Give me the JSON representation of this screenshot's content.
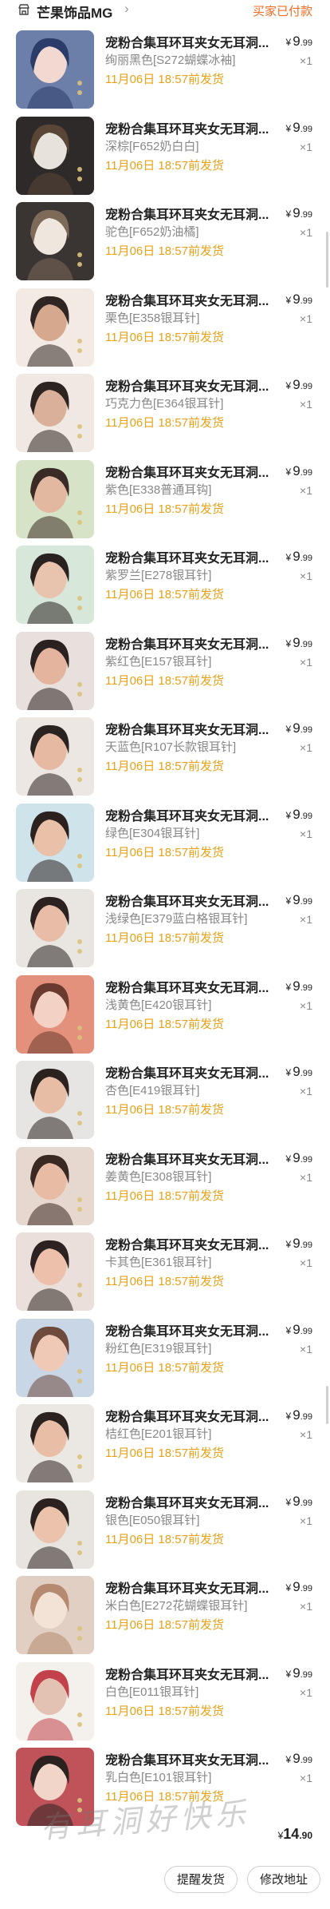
{
  "store": {
    "name": "芒果饰品MG",
    "chevron": "›",
    "status": "买家已付款",
    "icon": "store-icon"
  },
  "items": [
    {
      "title": "宠粉合集耳环耳夹女无耳洞...",
      "variant": "绚丽黑色[S272蝴蝶冰袖]",
      "ship": "11月06日 18:57前发货",
      "yen": "¥",
      "int": "9",
      "dec": ".99",
      "qty": "×1",
      "thumb": {
        "bg": "#6b7fa8",
        "fg": "#f1d8d0",
        "accent": "#2b3b6a"
      }
    },
    {
      "title": "宠粉合集耳环耳夹女无耳洞...",
      "variant": "深棕[F652奶白白]",
      "ship": "11月06日 18:57前发货",
      "yen": "¥",
      "int": "9",
      "dec": ".99",
      "qty": "×1",
      "thumb": {
        "bg": "#2f2a2a",
        "fg": "#e8e2dc",
        "accent": "#5a4636"
      }
    },
    {
      "title": "宠粉合集耳环耳夹女无耳洞...",
      "variant": "驼色[F652奶油橘]",
      "ship": "11月06日 18:57前发货",
      "yen": "¥",
      "int": "9",
      "dec": ".99",
      "qty": "×1",
      "thumb": {
        "bg": "#3a3433",
        "fg": "#efe6de",
        "accent": "#7e6a58"
      }
    },
    {
      "title": "宠粉合集耳环耳夹女无耳洞...",
      "variant": "栗色[E358银耳针]",
      "ship": "11月06日 18:57前发货",
      "yen": "¥",
      "int": "9",
      "dec": ".99",
      "qty": "×1",
      "thumb": {
        "bg": "#f3eae4",
        "fg": "#d6a98f",
        "accent": "#2f2624"
      }
    },
    {
      "title": "宠粉合集耳环耳夹女无耳洞...",
      "variant": "巧克力色[E364银耳针]",
      "ship": "11月06日 18:57前发货",
      "yen": "¥",
      "int": "9",
      "dec": ".99",
      "qty": "×1",
      "thumb": {
        "bg": "#f0e8e3",
        "fg": "#d9b19a",
        "accent": "#2d2421"
      }
    },
    {
      "title": "宠粉合集耳环耳夹女无耳洞...",
      "variant": "紫色[E338普通耳钩]",
      "ship": "11月06日 18:57前发货",
      "yen": "¥",
      "int": "9",
      "dec": ".99",
      "qty": "×1",
      "thumb": {
        "bg": "#d7e3c6",
        "fg": "#e3b8a1",
        "accent": "#3a2b26"
      }
    },
    {
      "title": "宠粉合集耳环耳夹女无耳洞...",
      "variant": "紫罗兰[E278银耳针]",
      "ship": "11月06日 18:57前发货",
      "yen": "¥",
      "int": "9",
      "dec": ".99",
      "qty": "×1",
      "thumb": {
        "bg": "#d7e7d9",
        "fg": "#e8c3ad",
        "accent": "#2a2221"
      }
    },
    {
      "title": "宠粉合集耳环耳夹女无耳洞...",
      "variant": "紫红色[E157银耳针]",
      "ship": "11月06日 18:57前发货",
      "yen": "¥",
      "int": "9",
      "dec": ".99",
      "qty": "×1",
      "thumb": {
        "bg": "#e8e0dc",
        "fg": "#e4b49f",
        "accent": "#2a2121"
      }
    },
    {
      "title": "宠粉合集耳环耳夹女无耳洞...",
      "variant": "天蓝色[R107长款银耳针]",
      "ship": "11月06日 18:57前发货",
      "yen": "¥",
      "int": "9",
      "dec": ".99",
      "qty": "×1",
      "thumb": {
        "bg": "#ece7e3",
        "fg": "#e6b9a3",
        "accent": "#2b2320"
      }
    },
    {
      "title": "宠粉合集耳环耳夹女无耳洞...",
      "variant": "绿色[E304银耳针]",
      "ship": "11月06日 18:57前发货",
      "yen": "¥",
      "int": "9",
      "dec": ".99",
      "qty": "×1",
      "thumb": {
        "bg": "#cfe3ea",
        "fg": "#e9c0a8",
        "accent": "#2b2220"
      }
    },
    {
      "title": "宠粉合集耳环耳夹女无耳洞...",
      "variant": "浅绿色[E379蓝白格银耳针]",
      "ship": "11月06日 18:57前发货",
      "yen": "¥",
      "int": "9",
      "dec": ".99",
      "qty": "×1",
      "thumb": {
        "bg": "#e9e6e2",
        "fg": "#e8bca6",
        "accent": "#2a2120"
      }
    },
    {
      "title": "宠粉合集耳环耳夹女无耳洞...",
      "variant": "浅黄色[E420银耳针]",
      "ship": "11月06日 18:57前发货",
      "yen": "¥",
      "int": "9",
      "dec": ".99",
      "qty": "×1",
      "thumb": {
        "bg": "#e3907c",
        "fg": "#f3d1c4",
        "accent": "#6a3a2e"
      }
    },
    {
      "title": "宠粉合集耳环耳夹女无耳洞...",
      "variant": "杏色[E419银耳针]",
      "ship": "11月06日 18:57前发货",
      "yen": "¥",
      "int": "9",
      "dec": ".99",
      "qty": "×1",
      "thumb": {
        "bg": "#e7e5e3",
        "fg": "#e7bda5",
        "accent": "#2b2220"
      }
    },
    {
      "title": "宠粉合集耳环耳夹女无耳洞...",
      "variant": "姜黄色[E308银耳针]",
      "ship": "11月06日 18:57前发货",
      "yen": "¥",
      "int": "9",
      "dec": ".99",
      "qty": "×1",
      "thumb": {
        "bg": "#e6d8cf",
        "fg": "#e8bca4",
        "accent": "#3a2823"
      }
    },
    {
      "title": "宠粉合集耳环耳夹女无耳洞...",
      "variant": "卡其色[E361银耳针]",
      "ship": "11月06日 18:57前发货",
      "yen": "¥",
      "int": "9",
      "dec": ".99",
      "qty": "×1",
      "thumb": {
        "bg": "#eadfda",
        "fg": "#ecc0ab",
        "accent": "#2c2221"
      }
    },
    {
      "title": "宠粉合集耳环耳夹女无耳洞...",
      "variant": "粉红色[E319银耳针]",
      "ship": "11月06日 18:57前发货",
      "yen": "¥",
      "int": "9",
      "dec": ".99",
      "qty": "×1",
      "thumb": {
        "bg": "#c9d6e6",
        "fg": "#efc9b6",
        "accent": "#6d4a3c"
      }
    },
    {
      "title": "宠粉合集耳环耳夹女无耳洞...",
      "variant": "桔红色[E201银耳针]",
      "ship": "11月06日 18:57前发货",
      "yen": "¥",
      "int": "9",
      "dec": ".99",
      "qty": "×1",
      "thumb": {
        "bg": "#ebe7e2",
        "fg": "#e9bea7",
        "accent": "#2b2220"
      }
    },
    {
      "title": "宠粉合集耳环耳夹女无耳洞...",
      "variant": "银色[E050银耳针]",
      "ship": "11月06日 18:57前发货",
      "yen": "¥",
      "int": "9",
      "dec": ".99",
      "qty": "×1",
      "thumb": {
        "bg": "#e8e5e1",
        "fg": "#ebc2ab",
        "accent": "#2b2220"
      }
    },
    {
      "title": "宠粉合集耳环耳夹女无耳洞...",
      "variant": "米白色[E272花蝴蝶银耳针]",
      "ship": "11月06日 18:57前发货",
      "yen": "¥",
      "int": "9",
      "dec": ".99",
      "qty": "×1",
      "thumb": {
        "bg": "#e0cfc2",
        "fg": "#f2e3d6",
        "accent": "#b58a70"
      }
    },
    {
      "title": "宠粉合集耳环耳夹女无耳洞...",
      "variant": "白色[E011银耳针]",
      "ship": "11月06日 18:57前发货",
      "yen": "¥",
      "int": "9",
      "dec": ".99",
      "qty": "×1",
      "thumb": {
        "bg": "#f4f0ec",
        "fg": "#e3c2b3",
        "accent": "#c2414b"
      }
    },
    {
      "title": "宠粉合集耳环耳夹女无耳洞...",
      "variant": "乳白色[E101银耳针]",
      "ship": "11月06日 18:57前发货",
      "yen": "¥",
      "int": "9",
      "dec": ".99",
      "qty": "×1",
      "thumb": {
        "bg": "#c0525a",
        "fg": "#f1d5c8",
        "accent": "#2b2220"
      }
    }
  ],
  "footer": {
    "total_yen": "¥",
    "total_int": "14",
    "total_dec": ".90",
    "watermark": "有耳洞好快乐",
    "remind_label": "提醒发货",
    "address_label": "修改地址"
  },
  "colors": {
    "status": "#f36c21",
    "ship": "#e7a21a"
  }
}
